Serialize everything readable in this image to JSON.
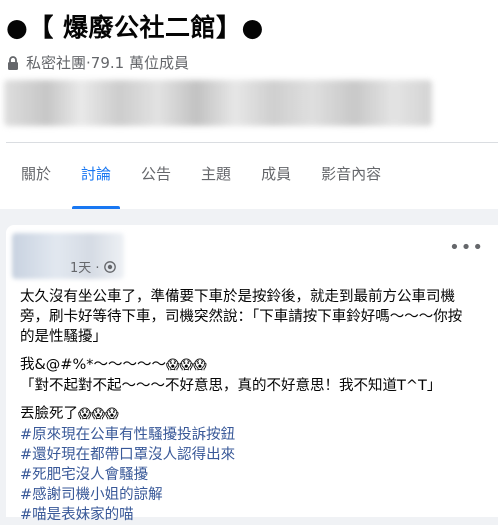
{
  "group": {
    "title": "●【 爆廢公社二館】●",
    "privacy": "私密社團",
    "separator": " · ",
    "members": "79.1 萬位成員"
  },
  "tabs": [
    {
      "label": "關於"
    },
    {
      "label": "討論",
      "active": true
    },
    {
      "label": "公告"
    },
    {
      "label": "主題"
    },
    {
      "label": "成員"
    },
    {
      "label": "影音內容"
    }
  ],
  "post": {
    "time": "1天 · ",
    "more": "•••",
    "paragraph1": [
      "太久沒有坐公車了，準備要下車於是按鈴後，就走到最前方公車司機",
      "旁，刷卡好等待下車，司機突然說：「下車請按下車鈴好嗎～～～你按",
      "的是性騷擾」"
    ],
    "line2": "我&@#%*～～～～～",
    "line2_emoji": "😱😱😱",
    "line3": "「對不起對不起～～～不好意思，真的不好意思！我不知道T^T」",
    "line4": "丟臉死了",
    "line4_emoji": "😱😱😱",
    "hashtags": [
      "#原來現在公車有性騷擾投訴按鈕",
      "#還好現在都帶口罩沒人認得出來",
      "#死肥宅沒人會騷擾",
      "#感謝司機小姐的諒解",
      "#喵是表妹家的喵"
    ]
  },
  "colors": {
    "accent": "#1877f2",
    "hashtag": "#385898",
    "secondary_text": "#65676b"
  }
}
